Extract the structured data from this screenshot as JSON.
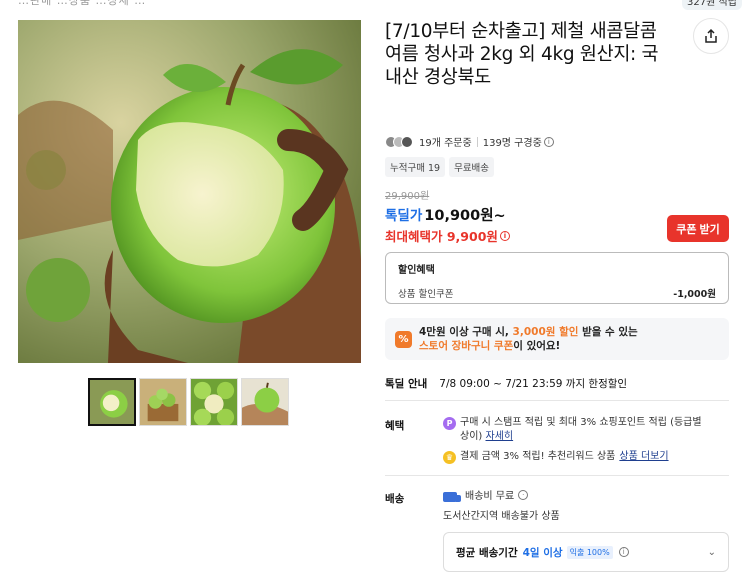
{
  "top": {
    "cut_text": "…판매 …상품 …상세 …",
    "badge": "327원 적립"
  },
  "product": {
    "title": "[7/10부터 순차출고] 제철 새콤달콤 여름 청사과 2kg 외 4kg 원산지: 국내산 경상북도",
    "order_count": "19개 주문중",
    "watchers": "139명 구경중",
    "tags": [
      "누적구매 19",
      "무료배송"
    ]
  },
  "price": {
    "original": "29,900원",
    "deal_label": "톡딜가",
    "deal_price": "10,900원~",
    "max_benefit": "최대혜택가 9,900원",
    "coupon_button": "쿠폰 받기"
  },
  "discount": {
    "title": "할인혜택",
    "line_label": "상품 할인쿠폰",
    "line_value": "-1,000원"
  },
  "promo": {
    "line1_a": "4만원 이상 구매 시,",
    "line1_hl": "3,000원 할인",
    "line1_b": "받을 수 있는",
    "line2_hl": "스토어 장바구니 쿠폰",
    "line2_b": "이 있어요!"
  },
  "deal_info": {
    "label": "톡딜 안내",
    "text": "7/8 09:00 ~ 7/21 23:59 까지 한정할인"
  },
  "benefits": {
    "label": "혜택",
    "item1": "구매 시 스탬프 적립 및 최대 3% 쇼핑포인트 적립 (등급별 상이)",
    "item1_link": "자세히",
    "item2": "결제 금액 3% 적립! 추천리워드 상품",
    "item2_link": "상품 더보기"
  },
  "shipping": {
    "label": "배송",
    "fee": "배송비 무료",
    "note": "도서산간지역 배송불가 상품",
    "avg_label": "평균 배송기간",
    "avg_value": "4일 이상",
    "avg_badge": "익출 100%"
  },
  "colors": {
    "accent_blue": "#1f6fe5",
    "accent_red": "#e8342b",
    "promo_orange": "#f07a2b"
  }
}
